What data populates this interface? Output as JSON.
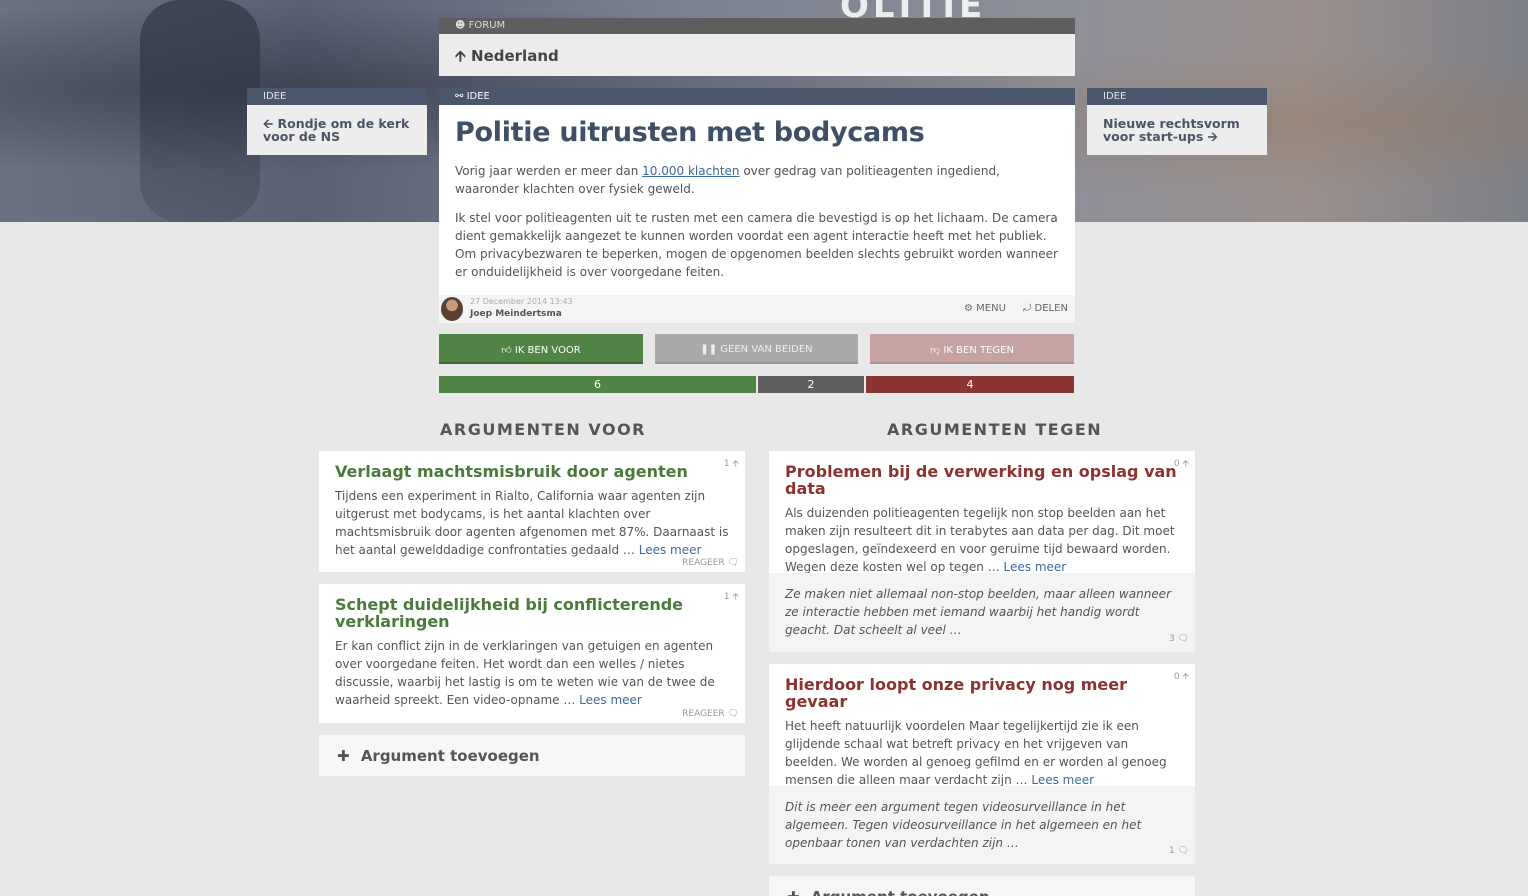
{
  "hero": {
    "badge_text": "OLITIE"
  },
  "forum": {
    "label": "Forum",
    "title": "Nederland"
  },
  "prev_idea": {
    "label": "Idee",
    "title": "Rondje om de kerk voor de NS"
  },
  "next_idea": {
    "label": "Idee",
    "title": "Nieuwe rechtsvorm voor start-ups"
  },
  "idea": {
    "label": "Idee",
    "title": "Politie uitrusten met bodycams",
    "p1_before": "Vorig jaar werden er meer dan ",
    "p1_link": "10.000 klachten",
    "p1_after": " over gedrag van politieagenten ingediend, waaronder klachten over fysiek geweld.",
    "p2": "Ik stel voor politieagenten uit te rusten met een camera die bevestigd is op het lichaam. De camera dient gemakkelijk aangezet te kunnen worden voordat een agent interactie heeft met het publiek. Om privacybezwaren te beperken, mogen de opgenomen beelden slechts gebruikt worden wanneer er onduidelijkheid is over voorgedane feiten.",
    "date": "27 December 2014 13:43",
    "author": "Joep Meindertsma",
    "menu_label": "Menu",
    "share_label": "Delen"
  },
  "votes": {
    "pro_label": "Ik ben voor",
    "neutral_label": "Geen van beiden",
    "con_label": "Ik ben tegen",
    "pro_count": "6",
    "neutral_count": "2",
    "con_count": "4",
    "colors": {
      "pro": "#4f8444",
      "neutral": "#a9a9a9",
      "con": "#c6a2a2",
      "pro_bar": "#4f8444",
      "neutral_bar": "#5e5e5e",
      "con_bar": "#8b3533"
    }
  },
  "arguments_pro": {
    "heading": "Argumenten voor",
    "items": [
      {
        "title": "Verlaagt machtsmisbruik door agenten",
        "text": "Tijdens een experiment in Rialto, California waar agenten zijn uitgerust met bodycams, is het aantal klachten over machtsmisbruik door agenten afgenomen met 87%. Daarnaast is het aantal gewelddadige confrontaties gedaald … ",
        "more": "Lees meer",
        "votes": "1",
        "reply": "Reageer"
      },
      {
        "title": "Schept duidelijkheid bij conflicterende verklaringen",
        "text": "Er kan conflict zijn in de verklaringen van getuigen en agenten over voorgedane feiten. Het wordt dan een welles / nietes discussie, waarbij het lastig is om te weten wie van de twee de waarheid spreekt. Een video-opname … ",
        "more": "Lees meer",
        "votes": "1",
        "reply": "Reageer"
      }
    ],
    "add_label": "Argument toevoegen"
  },
  "arguments_con": {
    "heading": "Argumenten tegen",
    "items": [
      {
        "title": "Problemen bij de verwerking en opslag van data",
        "text": "Als duizenden politieagenten tegelijk non stop beelden aan het maken zijn resulteert dit in terabytes aan data per dag. Dit moet opgeslagen, geïndexeerd en voor geruime tijd bewaard worden. Wegen deze kosten wel op tegen … ",
        "more": "Lees meer",
        "votes": "0",
        "comment": "Ze maken niet allemaal non-stop beelden, maar alleen wanneer ze interactie hebben met iemand waarbij het handig wordt geacht. Dat scheelt al veel …",
        "comment_count": "3"
      },
      {
        "title": "Hierdoor loopt onze privacy nog meer gevaar",
        "text": "Het heeft natuurlijk voordelen Maar tegelijkertijd zie ik een glijdende schaal wat betreft privacy en het vrijgeven van beelden. We worden al genoeg gefilmd en er worden al genoeg mensen die alleen maar verdacht zijn … ",
        "more": "Lees meer",
        "votes": "0",
        "comment": "Dit is meer een argument tegen videosurveillance in het algemeen. Tegen videosurveillance in het algemeen en het openbaar tonen van verdachten zijn …",
        "comment_count": "1"
      }
    ],
    "add_label": "Argument toevoegen"
  }
}
